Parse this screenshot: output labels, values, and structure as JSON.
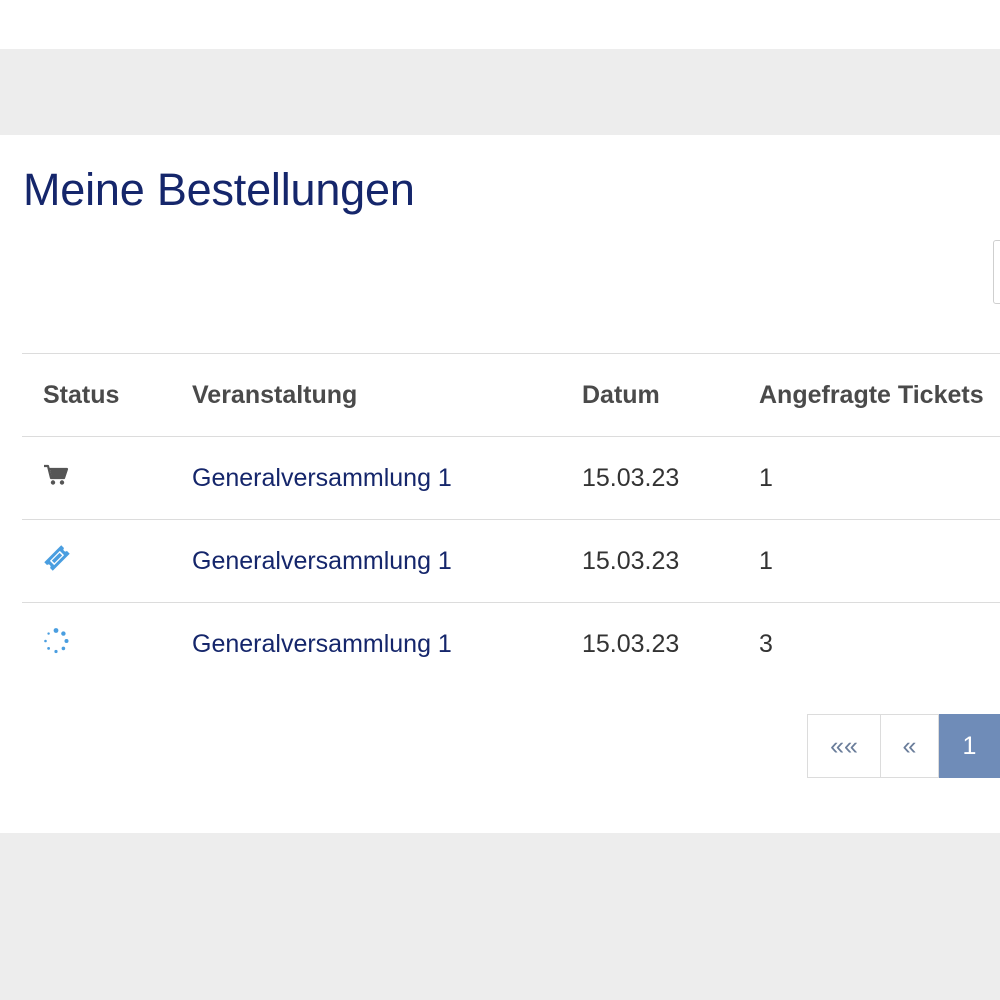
{
  "page": {
    "title": "Meine Bestellungen"
  },
  "table": {
    "columns": [
      "Status",
      "Veranstaltung",
      "Datum",
      "Angefragte Tickets"
    ],
    "rows": [
      {
        "status_icon": "cart-icon",
        "event": "Generalversammlung 1",
        "date": "15.03.23",
        "tickets": "1"
      },
      {
        "status_icon": "ticket-icon",
        "event": "Generalversammlung 1",
        "date": "15.03.23",
        "tickets": "1"
      },
      {
        "status_icon": "spinner-icon",
        "event": "Generalversammlung 1",
        "date": "15.03.23",
        "tickets": "3"
      }
    ]
  },
  "pagination": {
    "first": "««",
    "prev": "«",
    "current": "1"
  },
  "colors": {
    "title": "#15266b",
    "link": "#15266b",
    "icon_gray": "#555555",
    "icon_blue": "#4a9ee0",
    "page_active": "#6f8cb8",
    "band_gray": "#ededed"
  }
}
